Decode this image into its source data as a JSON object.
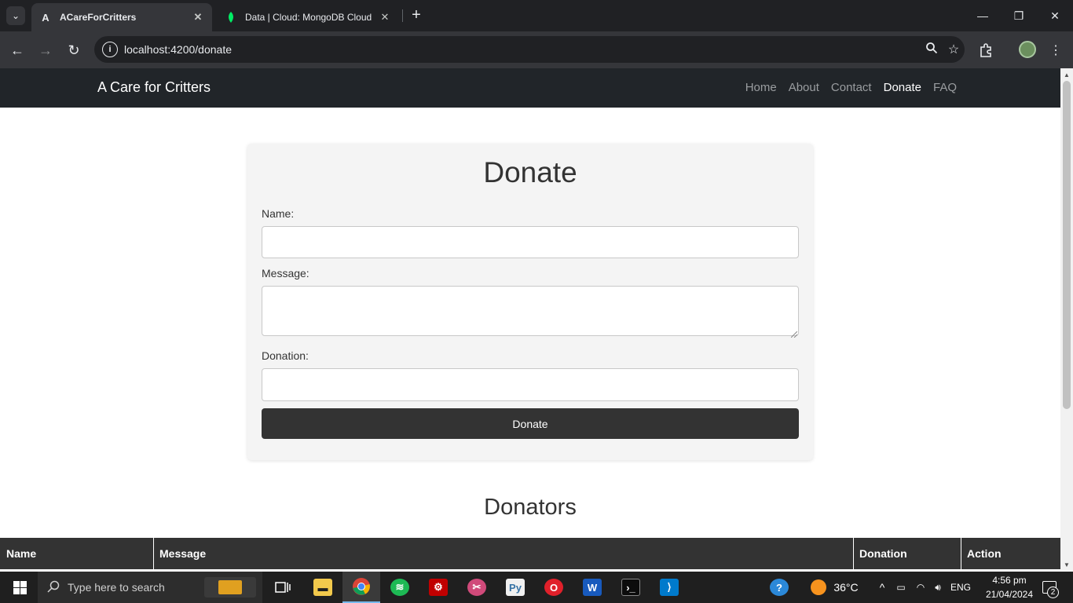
{
  "browser": {
    "tabs": [
      {
        "title": "ACareForCritters",
        "favicon": "A",
        "active": true
      },
      {
        "title": "Data | Cloud: MongoDB Cloud",
        "favicon": "leaf",
        "active": false
      }
    ],
    "url": "localhost:4200/donate"
  },
  "site": {
    "brand": "A Care for Critters",
    "nav": [
      {
        "label": "Home",
        "active": false
      },
      {
        "label": "About",
        "active": false
      },
      {
        "label": "Contact",
        "active": false
      },
      {
        "label": "Donate",
        "active": true
      },
      {
        "label": "FAQ",
        "active": false
      }
    ]
  },
  "form": {
    "title": "Donate",
    "name_label": "Name:",
    "name_value": "",
    "message_label": "Message:",
    "message_value": "",
    "donation_label": "Donation:",
    "donation_value": "",
    "submit_label": "Donate"
  },
  "donators": {
    "title": "Donators",
    "columns": [
      "Name",
      "Message",
      "Donation",
      "Action"
    ]
  },
  "taskbar": {
    "search_placeholder": "Type here to search",
    "weather": "36°C",
    "language": "ENG",
    "time": "4:56 pm",
    "date": "21/04/2024",
    "notifications": "2"
  },
  "colors": {
    "navbar": "#212529",
    "button": "#333333",
    "card": "#f4f4f4"
  }
}
